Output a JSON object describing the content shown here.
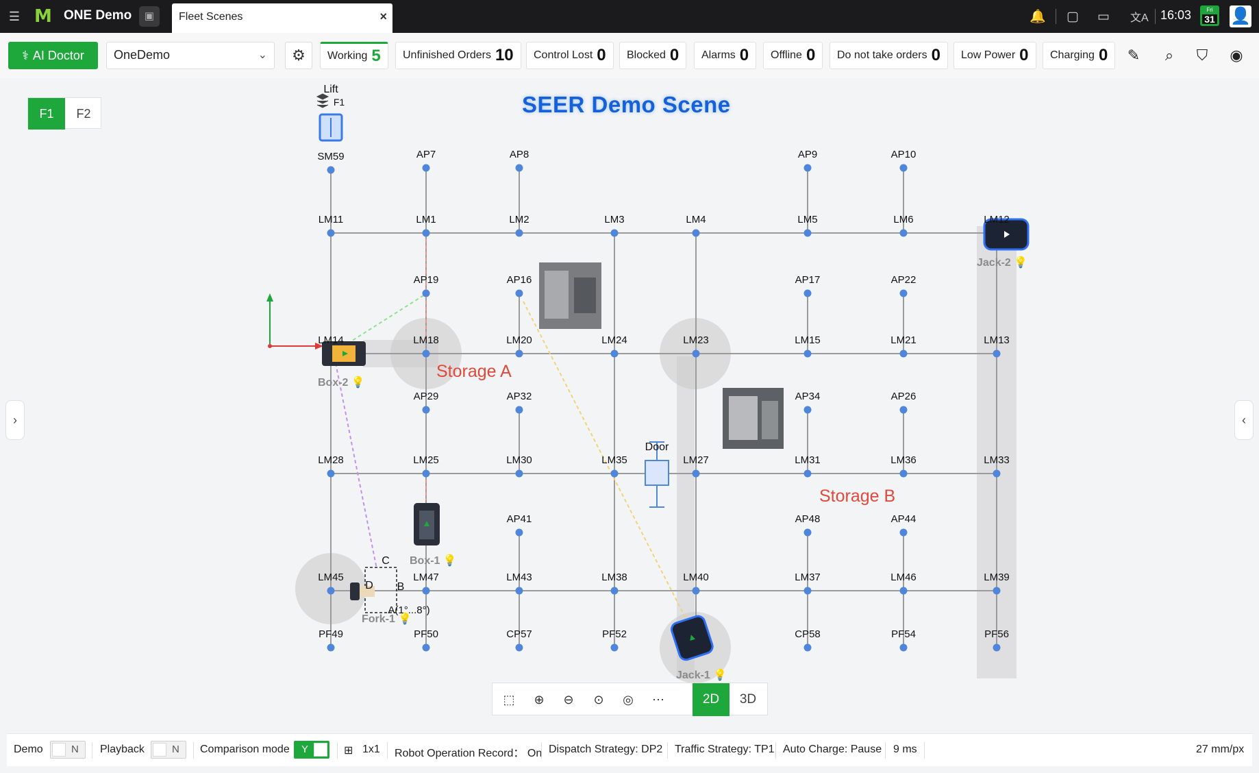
{
  "topbar": {
    "app_name": "ONE Demo",
    "tab_label": "Fleet Scenes",
    "time": "16:03",
    "calendar_day": "Fri",
    "calendar_date": "31"
  },
  "toolbar": {
    "ai_doctor_label": "AI Doctor",
    "scene_selected": "OneDemo",
    "statuses": [
      {
        "label": "Working",
        "count": "5",
        "active": true
      },
      {
        "label": "Unfinished Orders",
        "count": "10"
      },
      {
        "label": "Control Lost",
        "count": "0"
      },
      {
        "label": "Blocked",
        "count": "0"
      },
      {
        "label": "Alarms",
        "count": "0"
      },
      {
        "label": "Offline",
        "count": "0"
      },
      {
        "label": "Do not take orders",
        "count": "0"
      },
      {
        "label": "Low Power",
        "count": "0"
      },
      {
        "label": "Charging",
        "count": "0"
      }
    ]
  },
  "map": {
    "floors": [
      "F1",
      "F2"
    ],
    "active_floor": "F1",
    "scene_title": "SEER Demo Scene",
    "lift_label": "Lift",
    "lift_floor": "F1",
    "door_label": "Door",
    "storage_a": "Storage A",
    "storage_b": "Storage B",
    "robots": [
      "Jack-2",
      "Box-2",
      "Box-1",
      "Fork-1",
      "Jack-1"
    ],
    "fork_region_labels": [
      "C",
      "D",
      "B",
      "A(1°...8°)"
    ],
    "points": [
      "SM59",
      "AP7",
      "AP8",
      "AP9",
      "AP10",
      "LM11",
      "LM1",
      "LM2",
      "LM3",
      "LM4",
      "LM5",
      "LM6",
      "LM12",
      "AP19",
      "AP16",
      "AP17",
      "AP22",
      "LM14",
      "LM18",
      "LM20",
      "LM24",
      "LM23",
      "LM15",
      "LM21",
      "LM13",
      "AP29",
      "AP32",
      "AP34",
      "AP26",
      "LM28",
      "LM25",
      "LM30",
      "LM35",
      "LM27",
      "LM31",
      "LM36",
      "LM33",
      "AP41",
      "AP48",
      "AP44",
      "LM45",
      "LM47",
      "LM43",
      "LM38",
      "LM40",
      "LM37",
      "LM46",
      "LM39",
      "PF49",
      "PF50",
      "CP57",
      "PF52",
      "CP58",
      "PF54",
      "PF56"
    ],
    "view_modes": [
      "2D",
      "3D"
    ],
    "active_view": "2D"
  },
  "bottombar": {
    "demo_label": "Demo",
    "demo_value": "N",
    "playback_label": "Playback",
    "playback_value": "N",
    "comparison_label": "Comparison mode",
    "comparison_value": "Y",
    "grid_label": "1x1",
    "record": "Robot Operation Record： On",
    "dispatch": "Dispatch Strategy: DP2",
    "traffic": "Traffic Strategy: TP1",
    "auto_charge": "Auto Charge: Pause",
    "latency": "9 ms",
    "scale": "27 mm/px"
  },
  "colors": {
    "accent": "#1ea83b",
    "title_blue": "#1660d8",
    "storage_red": "#e04a3c",
    "node_blue": "#4f86d9"
  }
}
